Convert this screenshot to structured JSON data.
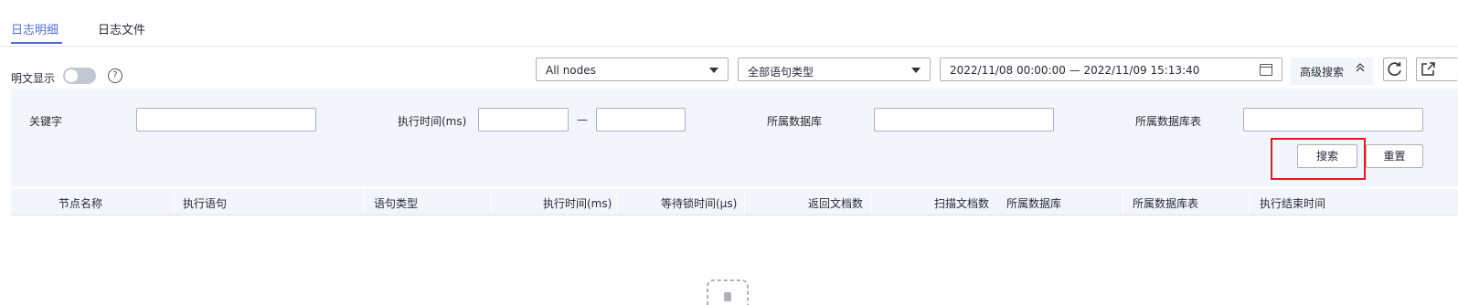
{
  "tabs": [
    {
      "label": "日志明细",
      "active": true
    },
    {
      "label": "日志文件",
      "active": false
    }
  ],
  "plaintext": {
    "label": "明文显示",
    "on": false,
    "help": "?"
  },
  "filters": {
    "node": "All nodes",
    "statement_type": "全部语句类型",
    "time_range": "2022/11/08 00:00:00 — 2022/11/09 15:13:40",
    "advanced_label": "高级搜索",
    "advanced_chevron": "︿"
  },
  "advanced": {
    "keyword_label": "关键字",
    "keyword_value": "",
    "exec_time_label": "执行时间(ms)",
    "exec_time_min": "",
    "range_sep": "—",
    "exec_time_max": "",
    "db_label": "所属数据库",
    "db_value": "",
    "table_label": "所属数据库表",
    "table_value": "",
    "search_button": "搜索",
    "reset_button": "重置"
  },
  "table": {
    "columns": [
      "节点名称",
      "执行语句",
      "语句类型",
      "执行时间(ms)",
      "等待锁时间(μs)",
      "返回文档数",
      "扫描文档数",
      "所属数据库",
      "所属数据库表",
      "执行结束时间"
    ]
  },
  "colors": {
    "accent": "#526ecc",
    "highlight": "#e0191e",
    "panel": "#f2f5fc"
  }
}
